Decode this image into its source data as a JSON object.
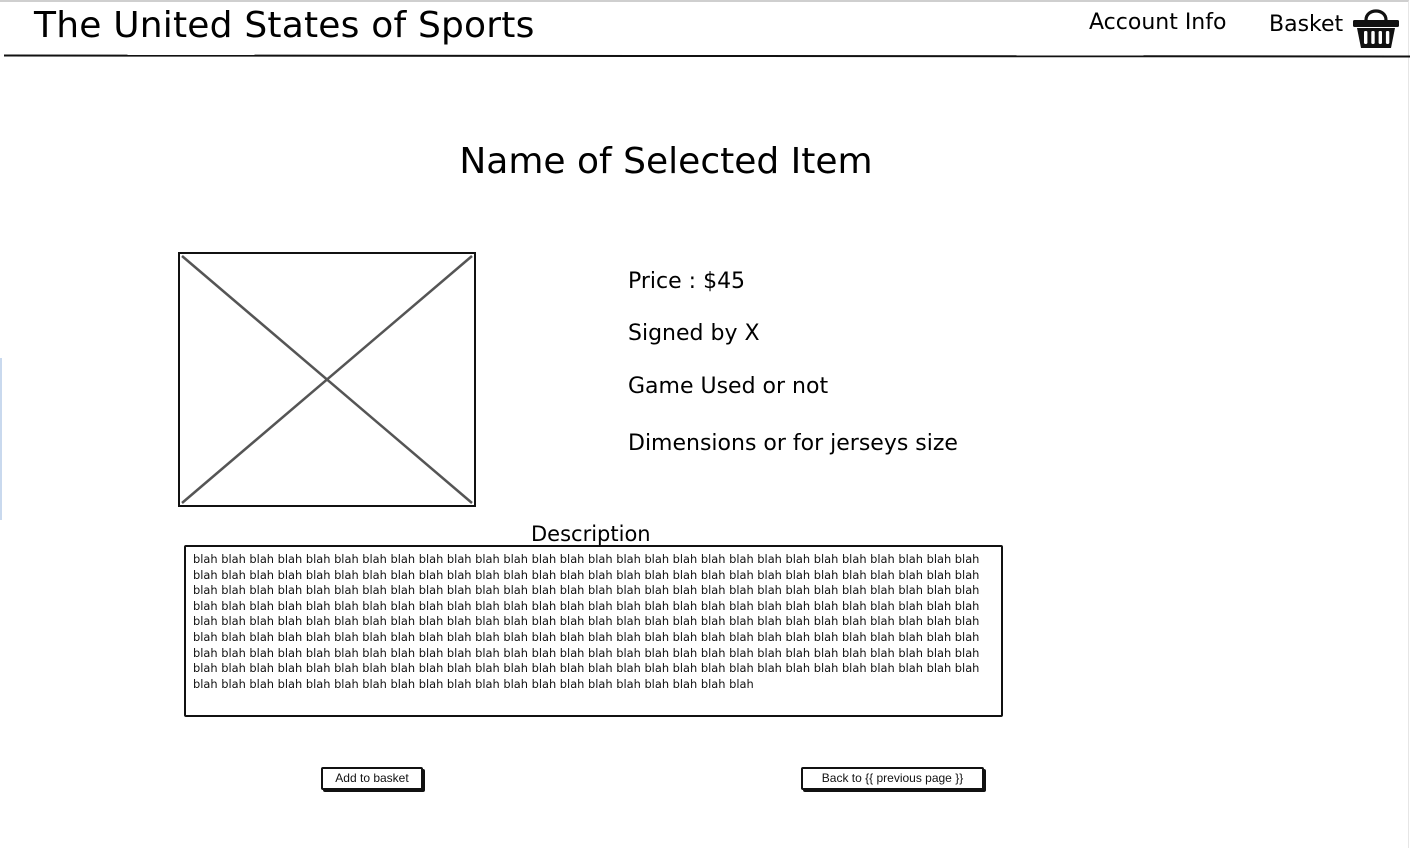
{
  "header": {
    "title": "The United States of Sports",
    "account_label": "Account Info",
    "basket_label": "Basket",
    "basket_icon": "basket-icon"
  },
  "product": {
    "title": "Name of Selected Item",
    "image_icon": "image-placeholder-icon",
    "price": "Price : $45",
    "signed": "Signed by X",
    "game_used": "Game Used or not",
    "dimensions": "Dimensions or for jerseys size"
  },
  "description": {
    "label": "Description",
    "text": "blah blah blah blah blah blah blah blah blah blah blah blah blah blah blah blah blah blah blah blah blah blah blah blah blah blah blah blah blah blah blah blah blah blah blah blah blah blah blah blah blah blah blah blah blah blah blah blah blah blah blah blah blah blah blah blah blah blah blah blah blah blah blah blah blah blah blah blah blah blah blah blah blah blah blah blah blah blah blah blah blah blah blah blah blah blah blah blah blah blah blah blah blah blah blah blah blah blah blah blah blah blah blah blah blah blah blah blah blah blah blah blah blah blah blah blah blah blah blah blah blah blah blah blah blah blah blah blah blah blah blah blah blah blah blah blah blah blah blah blah blah blah blah blah blah blah blah blah blah blah blah blah blah blah blah blah blah blah blah blah blah blah blah blah blah blah blah blah blah blah blah blah blah blah blah blah blah blah blah blah blah blah blah blah blah blah blah blah blah blah blah blah blah blah blah blah blah blah blah blah blah blah blah blah blah blah blah blah blah blah blah blah blah blah blah blah blah blah blah blah blah blah blah blah blah blah blah blah blah blah blah blah blah blah blah blah blah blah blah blah blah blah blah blah"
  },
  "actions": {
    "add_label": "Add to basket",
    "back_label": "Back to {{ previous page }}"
  }
}
